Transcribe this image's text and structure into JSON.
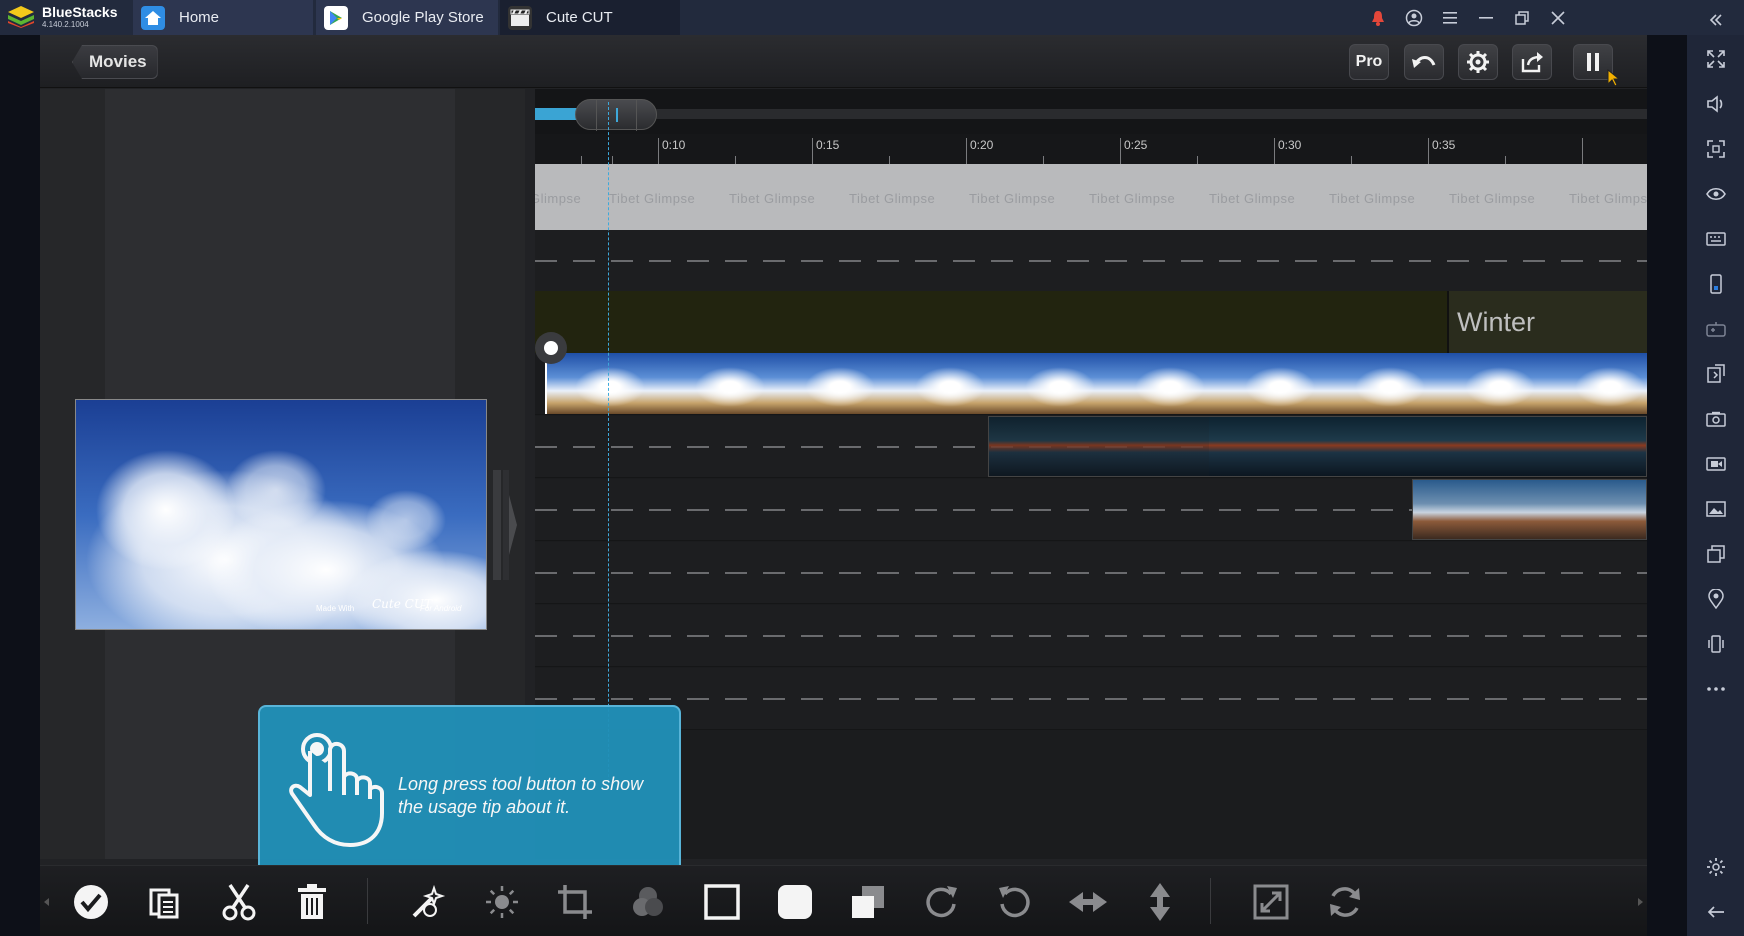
{
  "window": {
    "brand": "BlueStacks",
    "version": "4.140.2.1004",
    "tabs": [
      {
        "label": "Home"
      },
      {
        "label": "Google Play Store"
      },
      {
        "label": "Cute CUT"
      }
    ]
  },
  "app": {
    "back_label": "Movies",
    "pro_label": "Pro",
    "preview_watermark_made": "Made With",
    "preview_watermark_brand": "Cute CUT",
    "preview_watermark_platform": "For Android",
    "timeline": {
      "time_labels": [
        "0:10",
        "0:15",
        "0:20",
        "0:25",
        "0:30",
        "0:35"
      ],
      "music_track_text": "Tibet Glimpse",
      "title_clip_text": "Winter"
    },
    "tooltip_text": "Long press tool button to show the usage tip about it."
  },
  "colors": {
    "accent": "#3aa4d4",
    "tooltip": "#2190b8",
    "titlebar": "#222a3d",
    "sidebar": "#1f2638"
  },
  "icons": {
    "toolbar_top": [
      "undo-icon",
      "gear-icon",
      "share-icon",
      "pause-icon"
    ],
    "toolbar_bottom": [
      "check-icon",
      "copy-icon",
      "scissors-icon",
      "trash-icon",
      "magic-wand-icon",
      "brightness-icon",
      "crop-icon",
      "color-icon",
      "frame-icon",
      "rounded-frame-icon",
      "layer-icon",
      "rotate-right-icon",
      "rotate-left-icon",
      "flip-horizontal-icon",
      "flip-vertical-icon",
      "fullscreen-icon",
      "reset-icon"
    ],
    "sidebar": [
      "expand-icon",
      "volume-icon",
      "fullscreen-icon",
      "eye-icon",
      "keyboard-icon",
      "phone-icon",
      "gamepad-icon",
      "install-apk-icon",
      "camera-icon",
      "video-record-icon",
      "gallery-icon",
      "multi-instance-icon",
      "location-icon",
      "shake-icon",
      "more-icon",
      "settings-icon",
      "back-icon"
    ]
  }
}
